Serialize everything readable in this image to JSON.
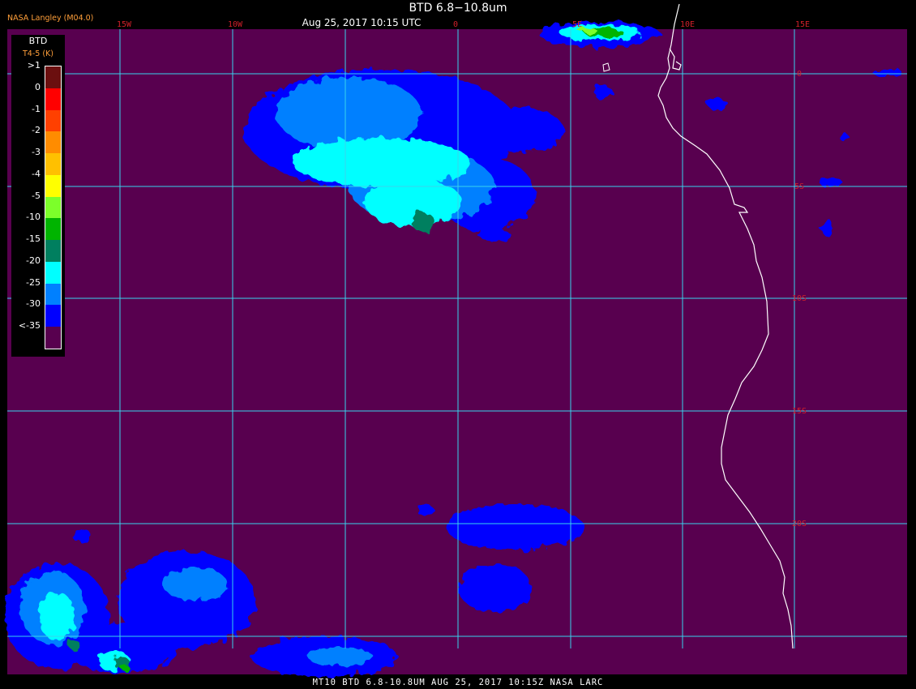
{
  "header": {
    "title": "BTD 6.8−10.8um",
    "datetime": "Aug 25, 2017 10:15 UTC",
    "producer": "NASA Langley (M04.0)"
  },
  "footer": {
    "caption": "MT10  BTD 6.8-10.8UM   AUG 25, 2017 10:15Z   NASA LARC"
  },
  "legend": {
    "title": "BTD",
    "units": "T4-5 (K)",
    "items": [
      {
        "label": ">1",
        "color": "#6b0f0f"
      },
      {
        "label": "0",
        "color": "#ff0000"
      },
      {
        "label": "-1",
        "color": "#ff4000"
      },
      {
        "label": "-2",
        "color": "#ff8c00"
      },
      {
        "label": "-3",
        "color": "#ffc000"
      },
      {
        "label": "-4",
        "color": "#ffff00"
      },
      {
        "label": "-5",
        "color": "#7cff2a"
      },
      {
        "label": "-10",
        "color": "#00b400"
      },
      {
        "label": "-15",
        "color": "#007f5f"
      },
      {
        "label": "-20",
        "color": "#00ffff"
      },
      {
        "label": "-25",
        "color": "#0080ff"
      },
      {
        "label": "-30",
        "color": "#0000ff"
      },
      {
        "label": "<-35",
        "color": "#58004f"
      }
    ]
  },
  "map": {
    "background_color": "#58004f",
    "grid_color": "#38d4ee",
    "coastline_color": "#ffffff",
    "label_color": "#d0202a",
    "lon_labels": [
      "15W",
      "10W",
      "0",
      "5E",
      "10E",
      "15E"
    ],
    "lat_labels": [
      "0",
      "5S",
      "10S",
      "15S",
      "20S"
    ]
  }
}
